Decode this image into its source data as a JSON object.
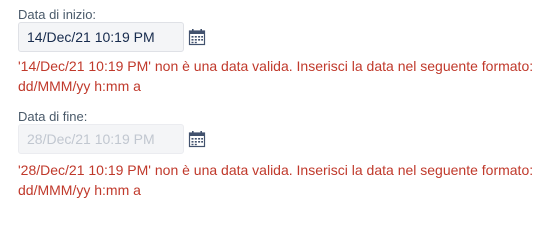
{
  "start": {
    "label": "Data di inizio:",
    "value": "14/Dec/21 10:19 PM",
    "error_line1": "'14/Dec/21 10:19 PM' non è una data valida. Inserisci la data nel seguente formato:",
    "error_line2": "dd/MMM/yy h:mm a",
    "calendar_icon": "calendar-icon"
  },
  "end": {
    "label": "Data di fine:",
    "value": "28/Dec/21 10:19 PM",
    "error_line1": "'28/Dec/21 10:19 PM' non è una data valida. Inserisci la data nel seguente formato:",
    "error_line2": "dd/MMM/yy h:mm a",
    "calendar_icon": "calendar-icon"
  },
  "colors": {
    "error": "#c0392b",
    "label": "#4a5a6a",
    "input_bg": "#f4f5f7"
  }
}
